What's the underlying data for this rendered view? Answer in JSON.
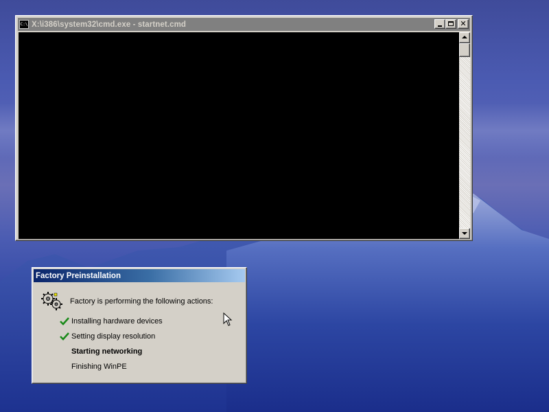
{
  "cmd_window": {
    "title": "X:\\i386\\system32\\cmd.exe - startnet.cmd",
    "app_icon_text": "C:\\",
    "console_output": ""
  },
  "factory_dialog": {
    "title": "Factory Preinstallation",
    "intro": "Factory is performing the following actions:",
    "steps": [
      {
        "label": "Installing hardware devices",
        "status": "done"
      },
      {
        "label": "Setting display resolution",
        "status": "done"
      },
      {
        "label": "Starting networking",
        "status": "in-progress"
      },
      {
        "label": "Finishing WinPE",
        "status": "pending"
      }
    ]
  },
  "colors": {
    "check_green": "#1a8a1a",
    "active_title_start": "#0a246a",
    "active_title_end": "#a6caf0",
    "inactive_title": "#808080"
  }
}
